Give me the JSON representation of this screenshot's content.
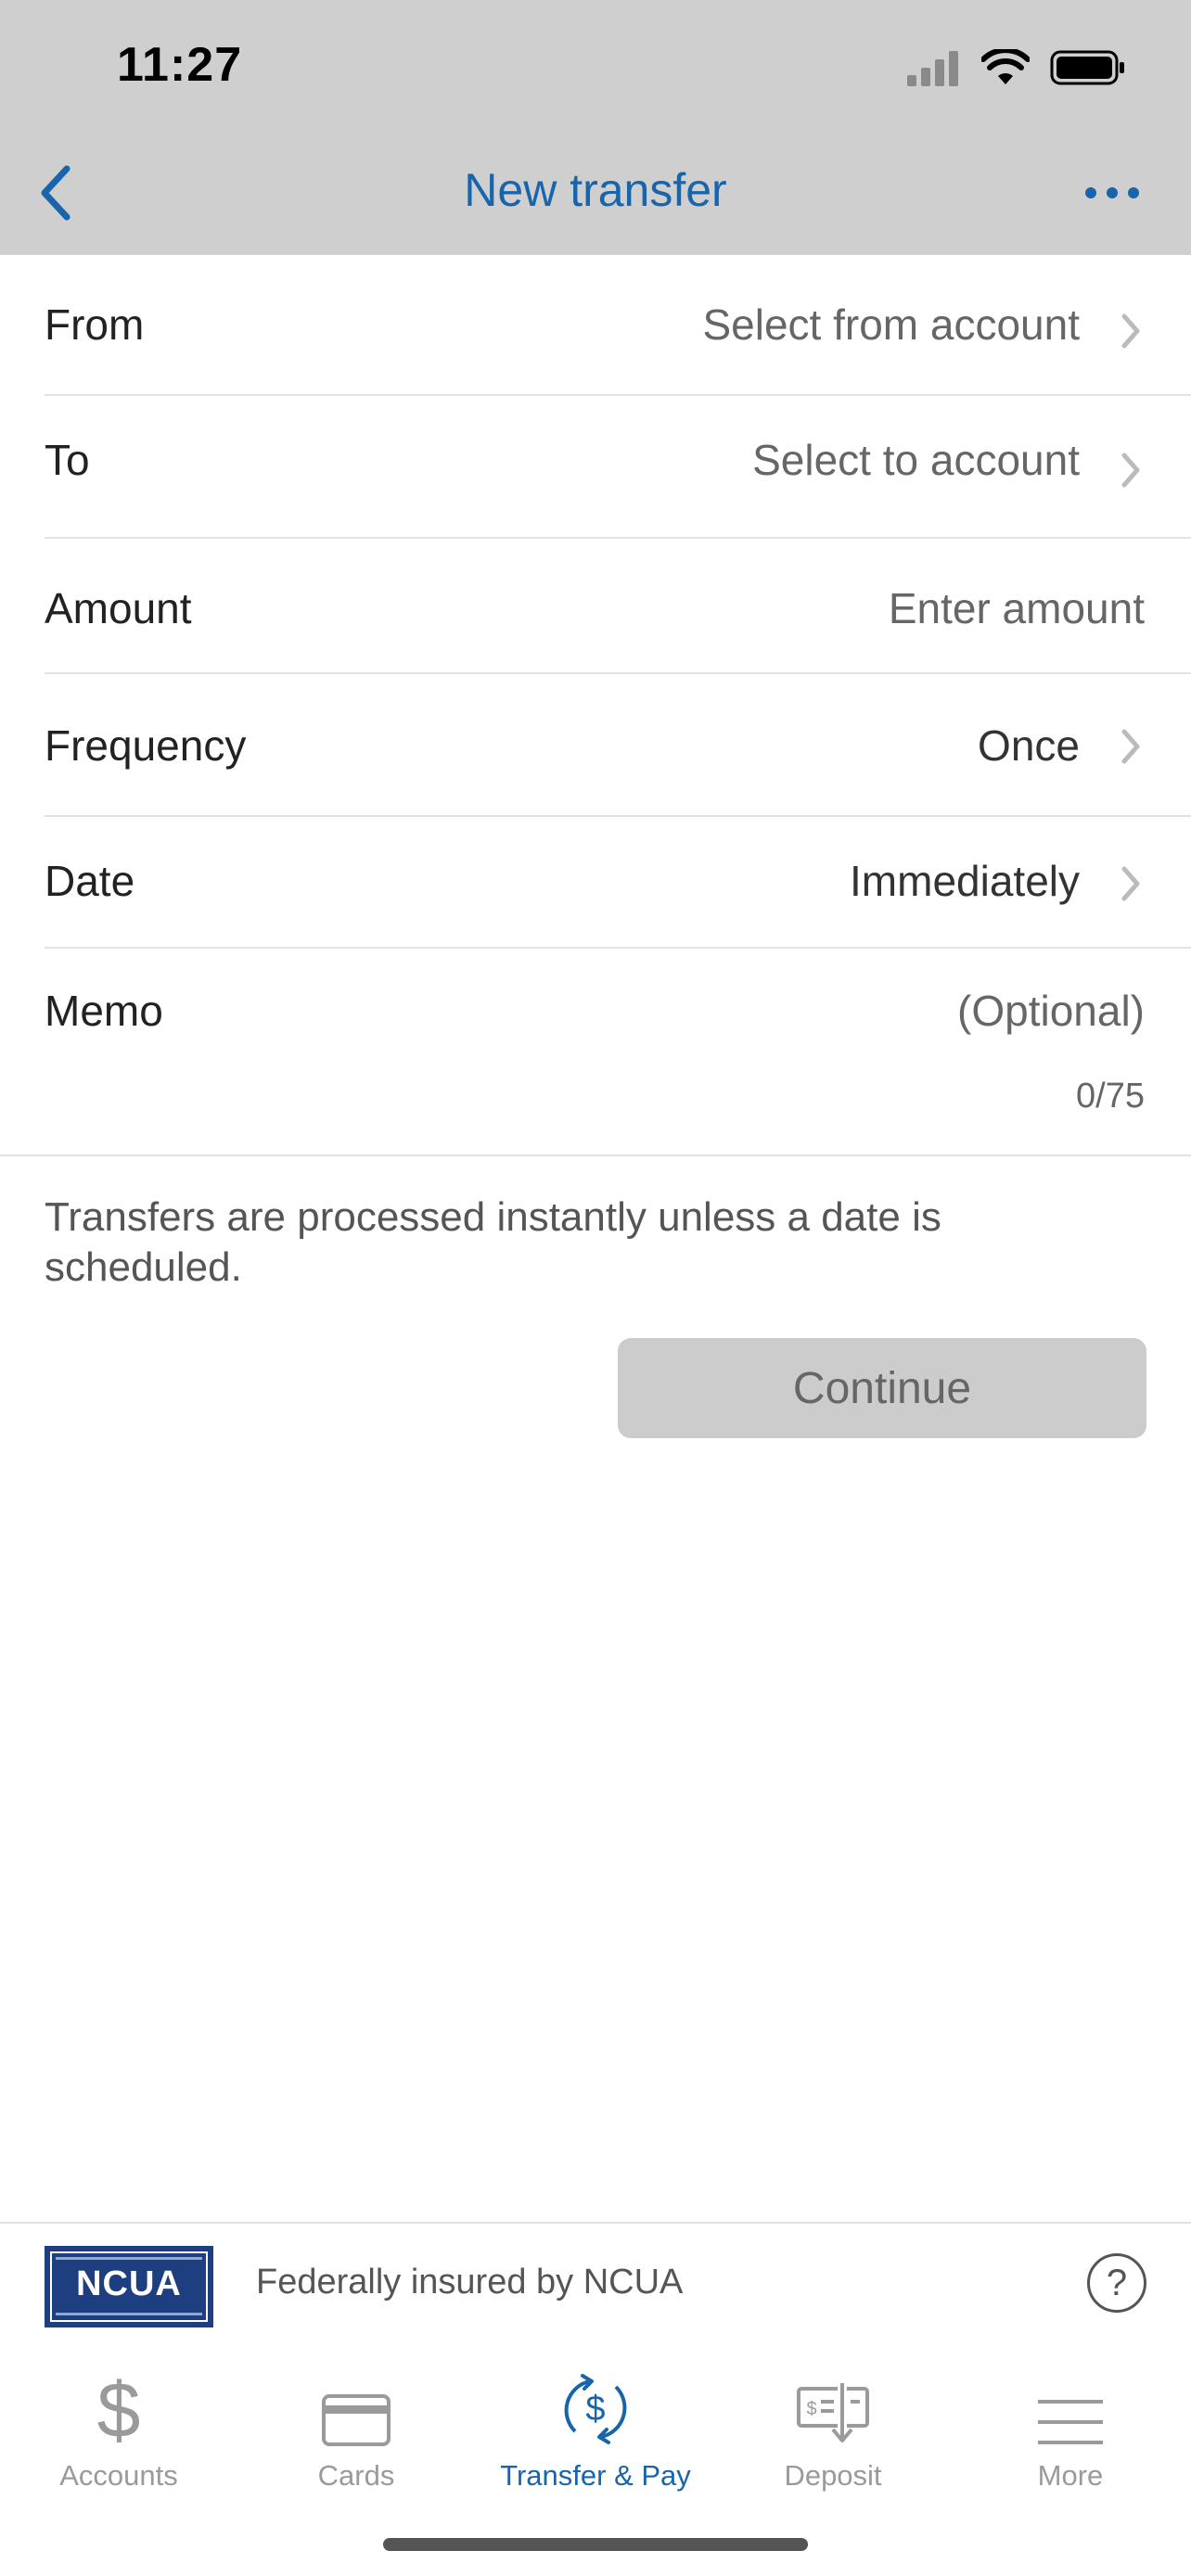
{
  "status_bar": {
    "time": "11:27"
  },
  "nav": {
    "title": "New transfer"
  },
  "form": {
    "from": {
      "label": "From",
      "value": "Select from account"
    },
    "to": {
      "label": "To",
      "value": "Select to account"
    },
    "amount": {
      "label": "Amount",
      "placeholder": "Enter amount"
    },
    "frequency": {
      "label": "Frequency",
      "value": "Once"
    },
    "date": {
      "label": "Date",
      "value": "Immediately"
    },
    "memo": {
      "label": "Memo",
      "placeholder": "(Optional)",
      "counter": "0/75"
    }
  },
  "note": "Transfers are processed instantly unless a date is scheduled.",
  "continue_label": "Continue",
  "insurance": {
    "logo_text": "NCUA",
    "text": "Federally insured by NCUA",
    "help": "?"
  },
  "tabs": [
    {
      "label": "Accounts",
      "icon": "dollar-icon"
    },
    {
      "label": "Cards",
      "icon": "card-icon"
    },
    {
      "label": "Transfer & Pay",
      "icon": "transfer-pay-icon",
      "active": true
    },
    {
      "label": "Deposit",
      "icon": "check-deposit-icon"
    },
    {
      "label": "More",
      "icon": "menu-icon"
    }
  ],
  "colors": {
    "accent": "#1865ab",
    "header_bg": "#cfcfcf",
    "button_disabled": "#cccccc"
  }
}
